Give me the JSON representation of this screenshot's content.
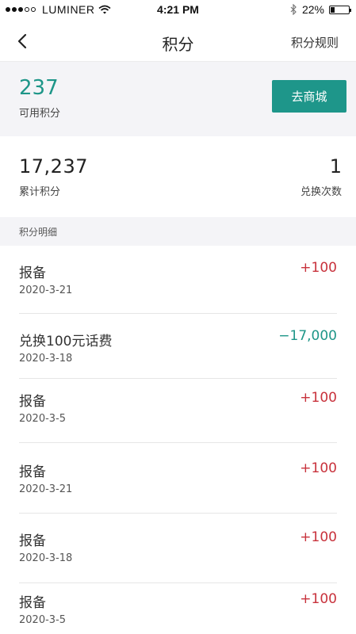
{
  "status_bar": {
    "carrier": "LUMINER",
    "time": "4:21 PM",
    "battery": "22%",
    "battery_level": 0.22,
    "signal_strength": 3
  },
  "nav": {
    "title": "积分",
    "rules_label": "积分规则"
  },
  "available": {
    "value": "237",
    "label": "可用积分",
    "mall_button": "去商城"
  },
  "totals": {
    "accumulated_value": "17,237",
    "accumulated_label": "累计积分",
    "exchange_value": "1",
    "exchange_label": "兑换次数"
  },
  "details": {
    "header": "积分明细",
    "records": [
      {
        "name": "报备",
        "date": "2020-3-21",
        "amount": "+100"
      },
      {
        "name": "兑换100元话费",
        "date": "2020-3-18",
        "amount": "−17,000"
      },
      {
        "name": "报备",
        "date": "2020-3-5",
        "amount": "+100"
      },
      {
        "name": "报备",
        "date": "2020-3-21",
        "amount": "+100"
      },
      {
        "name": "报备",
        "date": "2020-3-18",
        "amount": "+100"
      },
      {
        "name": "报备",
        "date": "2020-3-5",
        "amount": "+100"
      }
    ]
  },
  "colors": {
    "accent": "#1e968a",
    "positive_amount": "#c8323c",
    "negative_amount": "#1e9688",
    "section_background": "#f4f4f7"
  }
}
